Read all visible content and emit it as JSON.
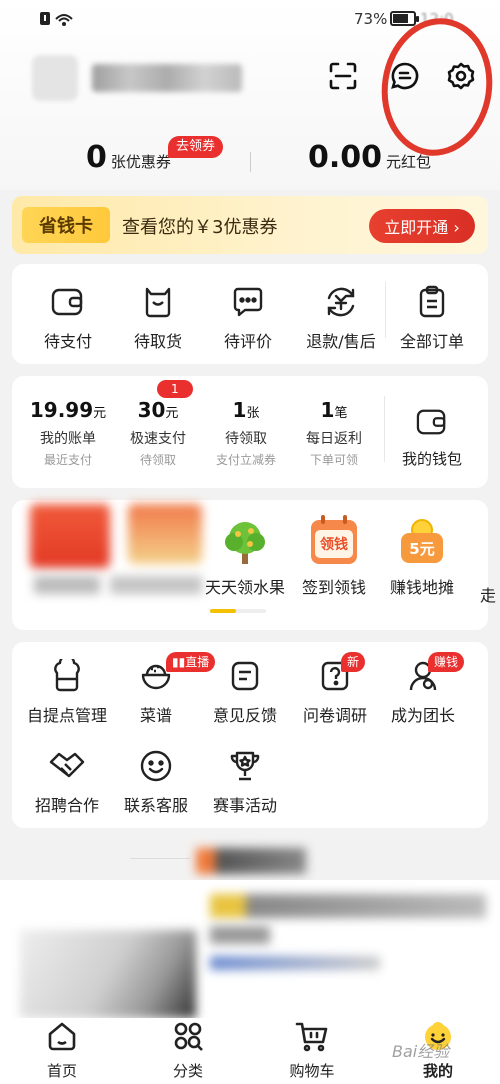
{
  "status_bar": {
    "battery_pct": "73%"
  },
  "header": {
    "scan_icon": "scan-icon",
    "message_icon": "message-icon",
    "settings_icon": "settings-gear-icon"
  },
  "coupons": {
    "coupon_count": "0",
    "coupon_unit": "张优惠券",
    "coupon_tag": "去领券",
    "redpacket_amount": "0.00",
    "redpacket_unit": "元红包"
  },
  "savings_card": {
    "badge": "省钱卡",
    "text": "查看您的￥3优惠券",
    "button": "立即开通 ›"
  },
  "orders": {
    "items": [
      {
        "label": "待支付",
        "icon": "wallet-icon"
      },
      {
        "label": "待取货",
        "icon": "bag-icon"
      },
      {
        "label": "待评价",
        "icon": "comment-icon"
      },
      {
        "label": "退款/售后",
        "icon": "refund-icon"
      },
      {
        "label": "全部订单",
        "icon": "clipboard-icon"
      }
    ]
  },
  "finance": {
    "items": [
      {
        "value": "19.99",
        "unit": "元",
        "label": "我的账单",
        "sub": "最近支付"
      },
      {
        "value": "30",
        "unit": "元",
        "label": "极速支付",
        "sub": "待领取",
        "badge": "1"
      },
      {
        "value": "1",
        "unit": "张",
        "label": "待领取",
        "sub": "支付立减券"
      },
      {
        "value": "1",
        "unit": "笔",
        "label": "每日返利",
        "sub": "下单可领"
      }
    ],
    "wallet_label": "我的钱包"
  },
  "promos": {
    "items": [
      {
        "label": "天天领水果",
        "icon": "fruit-tree-icon"
      },
      {
        "label": "签到领钱",
        "icon": "calendar-coin-icon",
        "icon_text": "领钱"
      },
      {
        "label": "赚钱地摊",
        "icon": "coin-stall-icon",
        "icon_text": "5元"
      },
      {
        "label": "走"
      }
    ]
  },
  "tools": {
    "row1": [
      {
        "label": "自提点管理",
        "icon": "store-icon"
      },
      {
        "label": "菜谱",
        "icon": "rice-bowl-icon",
        "badge": "直播"
      },
      {
        "label": "意见反馈",
        "icon": "feedback-icon"
      },
      {
        "label": "问卷调研",
        "icon": "survey-icon",
        "badge": "新"
      },
      {
        "label": "成为团长",
        "icon": "person-icon",
        "badge": "赚钱"
      }
    ],
    "row2": [
      {
        "label": "招聘合作",
        "icon": "handshake-icon"
      },
      {
        "label": "联系客服",
        "icon": "service-smile-icon"
      },
      {
        "label": "赛事活动",
        "icon": "trophy-icon"
      }
    ]
  },
  "bottom_nav": {
    "items": [
      {
        "label": "首页",
        "icon": "home-icon"
      },
      {
        "label": "分类",
        "icon": "category-icon"
      },
      {
        "label": "购物车",
        "icon": "cart-icon"
      },
      {
        "label": "我的",
        "icon": "profile-face-icon"
      }
    ]
  },
  "colors": {
    "accent_red": "#e9302f",
    "annotation_red": "#e0382b",
    "gold": "#ffc93a"
  }
}
